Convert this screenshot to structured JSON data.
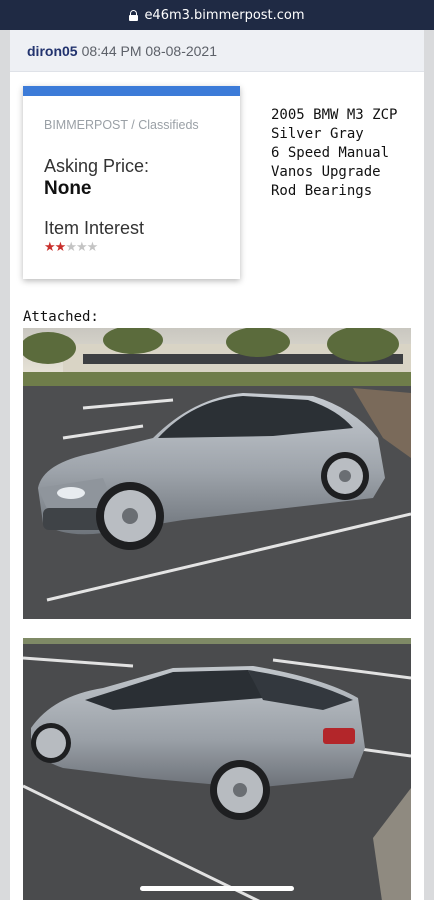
{
  "browser": {
    "url": "e46m3.bimmerpost.com"
  },
  "post": {
    "author": "diron05",
    "datetime": "08:44 PM 08-08-2021"
  },
  "card": {
    "breadcrumb": "BIMMERPOST / Classifieds",
    "asking_price_label": "Asking Price:",
    "asking_price_value": "None",
    "item_interest_label": "Item Interest",
    "interest_rating": 2,
    "interest_max": 5
  },
  "specs": [
    "2005 BMW M3 ZCP",
    "Silver Gray",
    "6 Speed Manual",
    "Vanos Upgrade",
    "Rod Bearings"
  ],
  "attachments": {
    "label": "Attached:"
  },
  "colors": {
    "accent": "#3c7bd8",
    "author": "#22336e",
    "url_bar": "#1f2a44",
    "star_on": "#c9302c"
  },
  "icons": {
    "url_lock": "lock-icon",
    "rating": "star-icon"
  }
}
